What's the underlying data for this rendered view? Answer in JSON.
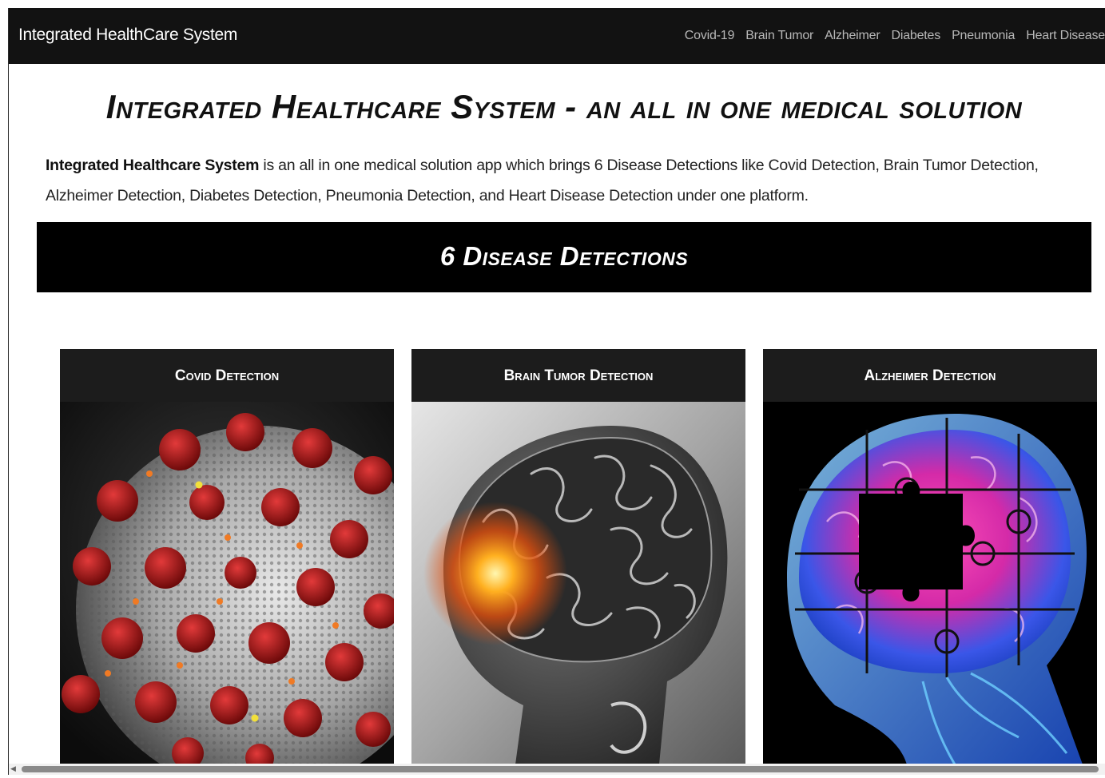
{
  "navbar": {
    "brand": "Integrated HealthCare System",
    "links": [
      "Covid-19",
      "Brain Tumor",
      "Alzheimer",
      "Diabetes",
      "Pneumonia",
      "Heart Disease"
    ]
  },
  "hero": {
    "title": "Integrated Healthcare System - an all in one medical solution",
    "intro_bold": "Integrated Healthcare System",
    "intro_rest": " is an all in one medical solution app which brings 6 Disease Detections like Covid Detection, Brain Tumor Detection, Alzheimer Detection, Diabetes Detection, Pneumonia Detection, and Heart Disease Detection under one platform."
  },
  "section": {
    "title": "6 Disease Detections"
  },
  "cards": [
    {
      "title": "Covid Detection"
    },
    {
      "title": "Brain Tumor Detection"
    },
    {
      "title": "Alzheimer Detection"
    }
  ],
  "icons": {
    "scroll_left": "scroll-left-arrow-icon"
  },
  "colors": {
    "navbar": "#121212",
    "banner": "#000000",
    "card_header": "#1c1c1c"
  }
}
